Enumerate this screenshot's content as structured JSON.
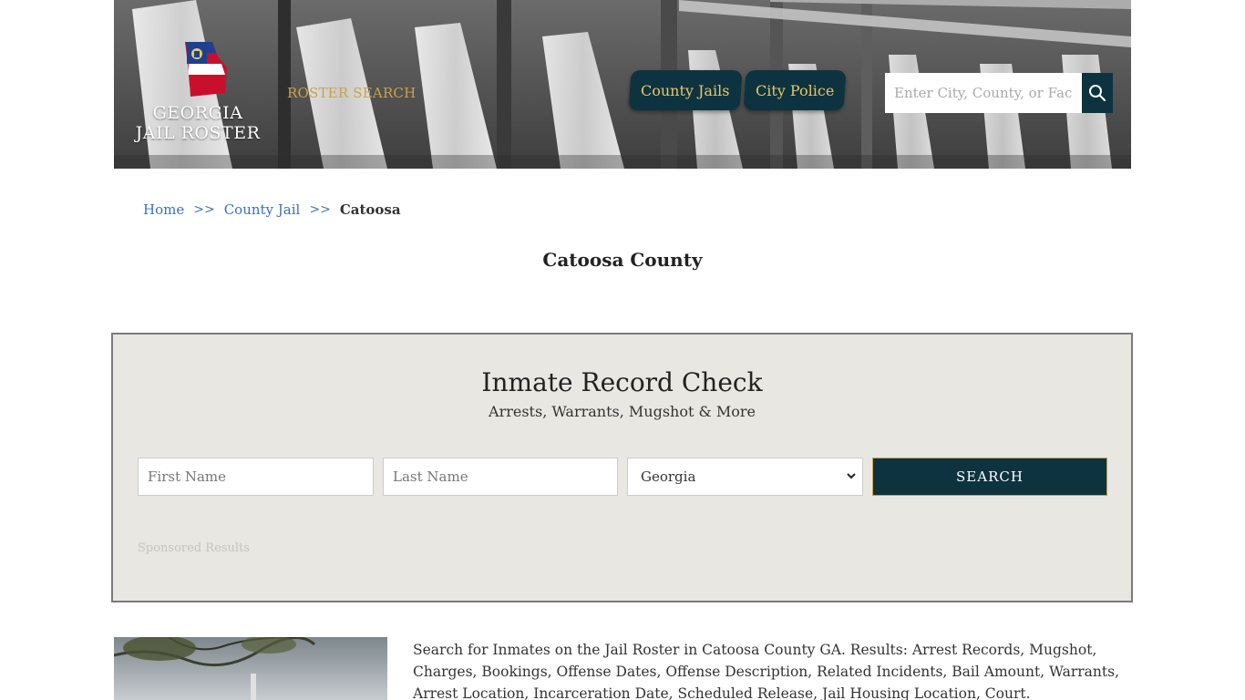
{
  "header": {
    "logo": {
      "line1": "GEORGIA",
      "line2": "JAIL ROSTER"
    },
    "roster_search_label": "ROSTER SEARCH",
    "nav": {
      "county_jails": "County Jails",
      "city_police": "City Police"
    },
    "search": {
      "placeholder": "Enter City, County, or Facility",
      "icon": "search-icon"
    }
  },
  "breadcrumb": {
    "home": "Home",
    "separator": ">>",
    "county_jail": "County Jail",
    "current": "Catoosa"
  },
  "page_title": "Catoosa County",
  "record_check": {
    "title": "Inmate Record Check",
    "subtitle": "Arrests, Warrants, Mugshot & More",
    "first_name_placeholder": "First Name",
    "last_name_placeholder": "Last Name",
    "state_selected": "Georgia",
    "submit_label": "SEARCH",
    "sponsored_label": "Sponsored Results"
  },
  "description": "Search for Inmates on the Jail Roster in Catoosa County GA. Results: Arrest Records, Mugshot, Charges, Bookings, Offense Dates, Offense Description, Related Incidents, Bail Amount, Warrants, Arrest Location, Incarceration Date, Scheduled Release, Jail Housing Location, Court.",
  "colors": {
    "brand_dark": "#0e3340",
    "gold_accent": "#e6c766",
    "link_blue": "#3d6fbf",
    "panel_bg": "#e8e7e2"
  }
}
